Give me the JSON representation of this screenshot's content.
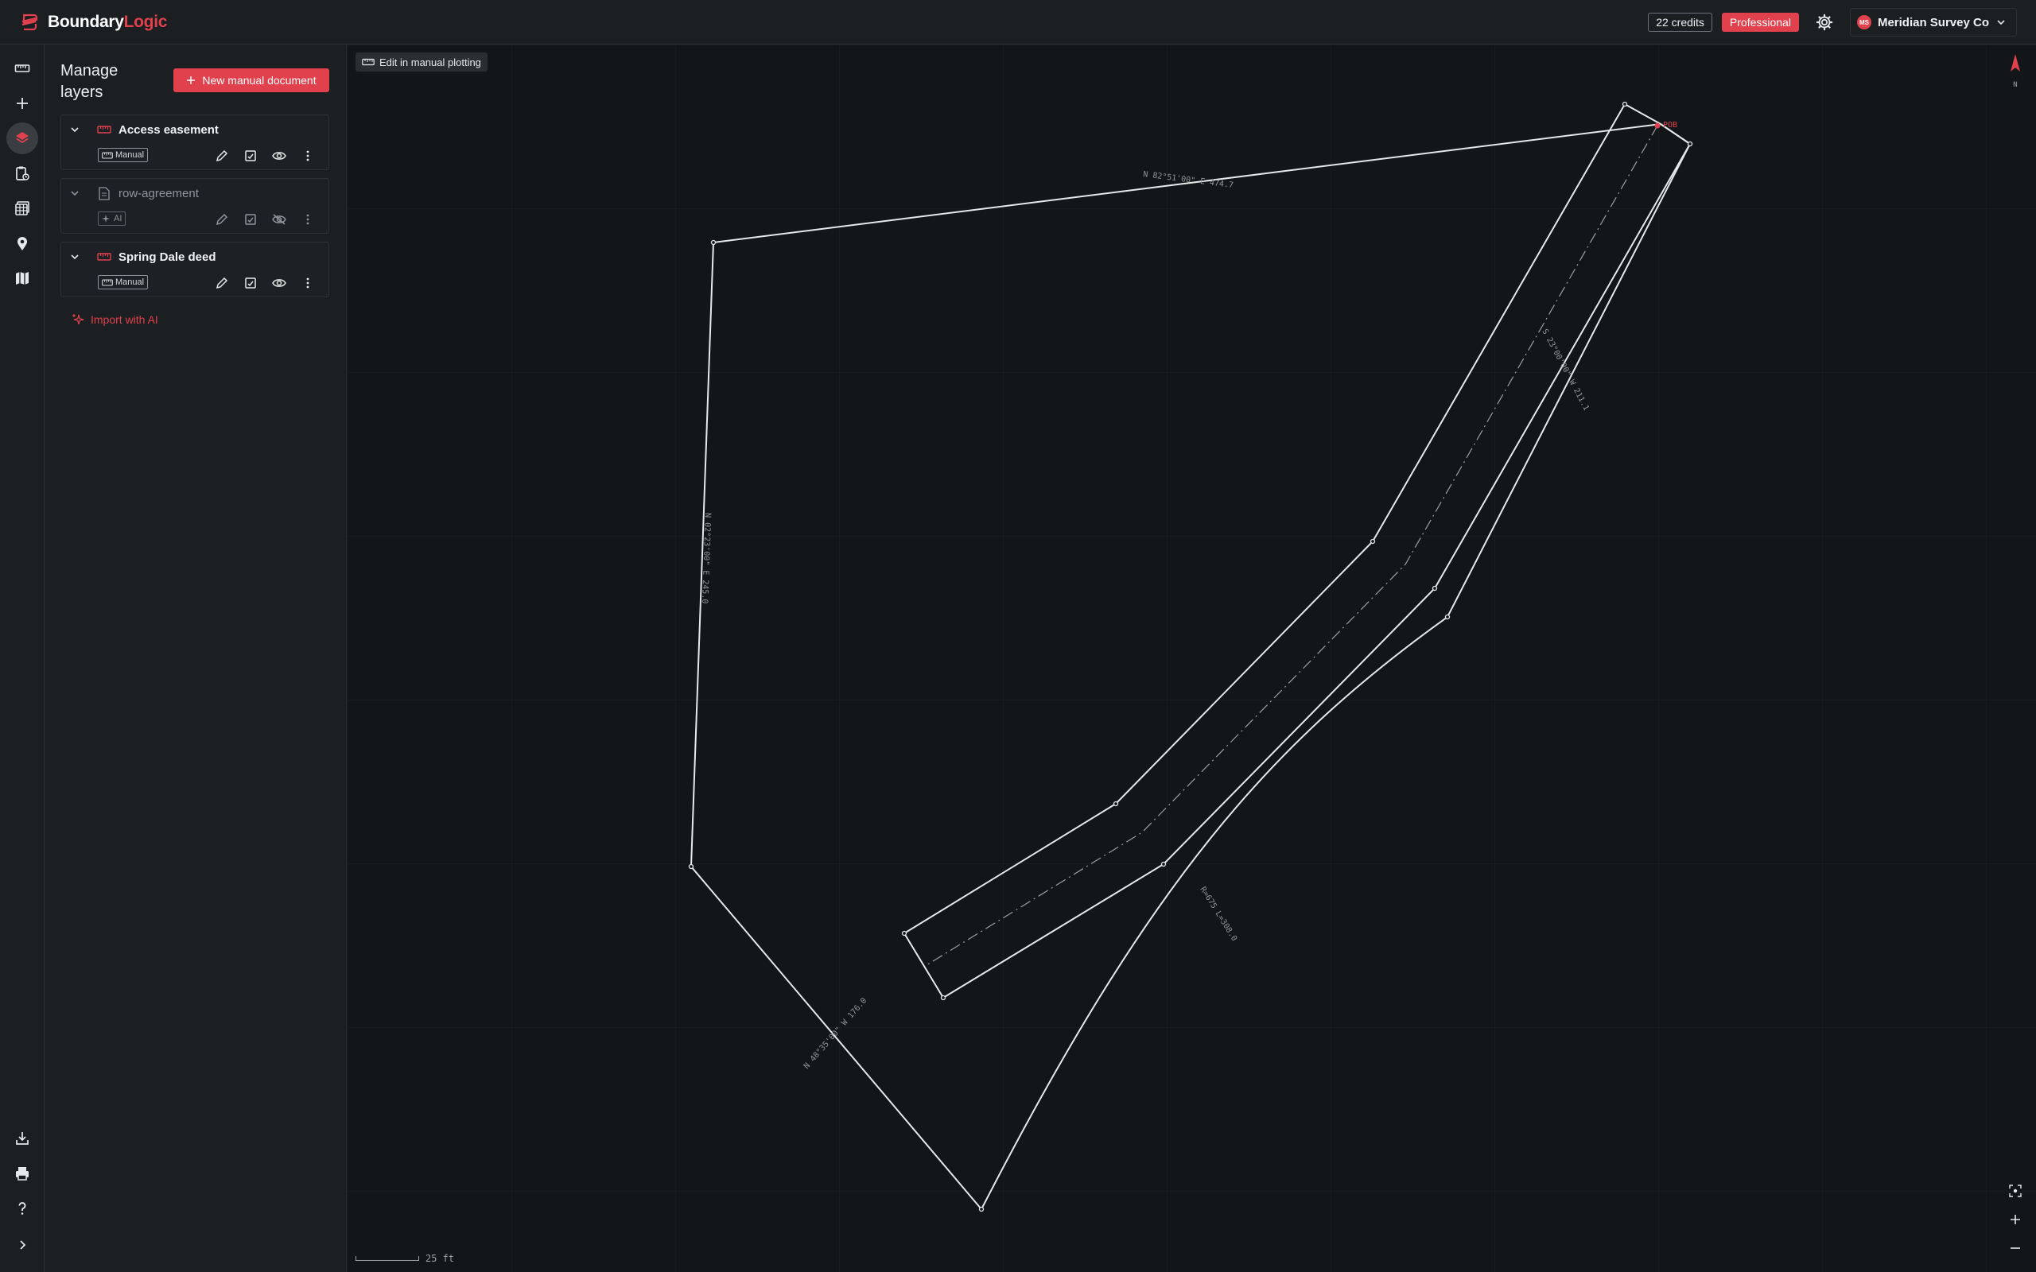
{
  "app": {
    "brand_main": "Boundary",
    "brand_accent": "Logic"
  },
  "header": {
    "credits": "22 credits",
    "plan": "Professional",
    "org_initials": "MS",
    "org_name": "Meridian Survey Co"
  },
  "rail": {
    "top_items": [
      "ruler-icon",
      "plus-icon",
      "layers-icon",
      "clipboard-icon",
      "table-icon",
      "pin-icon",
      "map-icon"
    ],
    "bottom_items": [
      "download-icon",
      "print-icon",
      "help-icon",
      "expand-icon"
    ],
    "active": "layers-icon"
  },
  "panel": {
    "title": "Manage layers",
    "new_doc_label": "New manual document",
    "import_label": "Import with AI",
    "layers": [
      {
        "name": "Access easement",
        "badge": "Manual",
        "type": "manual",
        "visible": true,
        "dim": false
      },
      {
        "name": "row-agreement",
        "badge": "AI",
        "type": "ai",
        "visible": false,
        "dim": true
      },
      {
        "name": "Spring Dale deed",
        "badge": "Manual",
        "type": "manual",
        "visible": true,
        "dim": false
      }
    ]
  },
  "map": {
    "edit_label": "Edit in manual plotting",
    "north_label": "N",
    "scale_label": "25 ft",
    "pob_label": "POB",
    "call_labels": {
      "top": "N 82°51'00\" E 474.7",
      "left": "N 02°23'00\" E 245.0",
      "bottom_left": "N 48°35'00\" W 176.0",
      "curve": "R=675 L=308.0",
      "right": "S 23°00'00\" W 211.1"
    }
  },
  "colors": {
    "accent": "#e0414d",
    "line": "#e6e8ea",
    "background": "#131619",
    "panel": "#1c1f22"
  }
}
